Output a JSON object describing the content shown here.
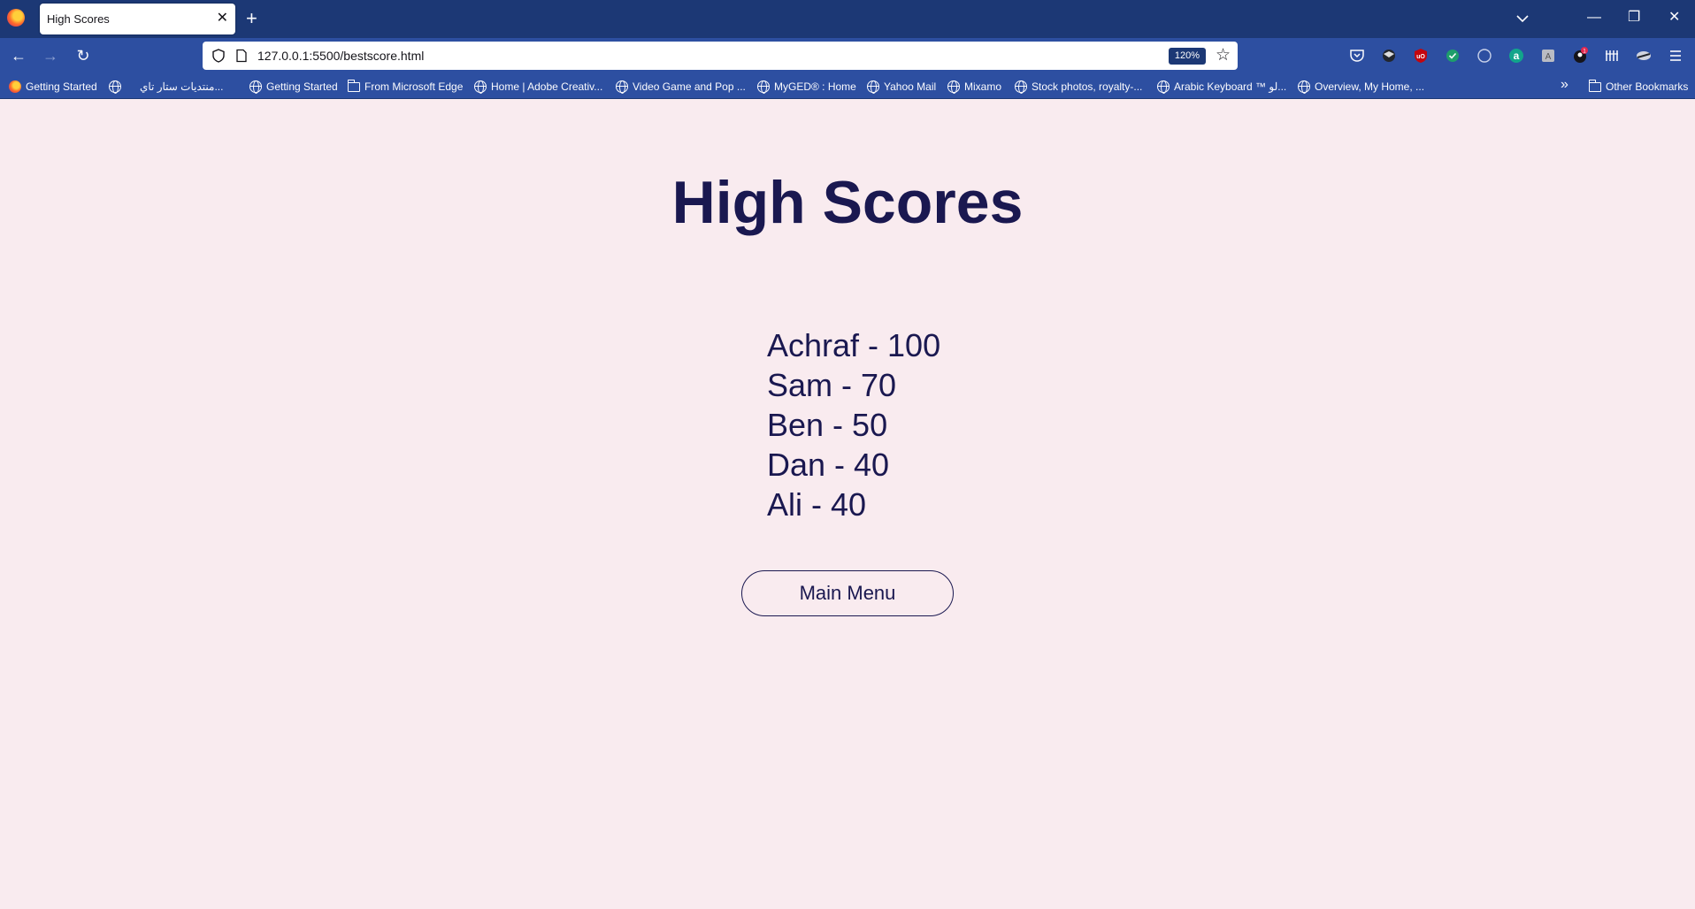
{
  "browser": {
    "tab": {
      "title": "High Scores",
      "close": "✕"
    },
    "new_tab": "+",
    "window_controls": {
      "minimize": "—",
      "restore": "❐",
      "close": "✕"
    },
    "nav": {
      "back": "←",
      "forward": "→",
      "reload": "↻"
    },
    "url": "127.0.0.1:5500/bestscore.html",
    "zoom": "120%",
    "bookmark_star": "☆",
    "extensions": [
      "pocket-icon",
      "extension-mask-icon",
      "ublock-icon",
      "check-extension-icon",
      "circle-extension-icon",
      "amazon-a-icon",
      "grey-extension-icon",
      "account-badge-icon",
      "library-icon",
      "sync-icon",
      "menu-icon"
    ],
    "extension_badge": "1",
    "bookmarks": [
      {
        "label": "Getting Started",
        "icon": "firefox-icon"
      },
      {
        "label": "",
        "icon": "globe-icon"
      },
      {
        "label": "منتديات ستار تاي...",
        "icon": "none"
      },
      {
        "label": "Getting Started",
        "icon": "globe-icon"
      },
      {
        "label": "From Microsoft Edge",
        "icon": "folder-icon"
      },
      {
        "label": "Home | Adobe Creativ...",
        "icon": "globe-icon"
      },
      {
        "label": "Video Game and Pop ...",
        "icon": "globe-icon"
      },
      {
        "label": "MyGED® : Home",
        "icon": "globe-icon"
      },
      {
        "label": "Yahoo Mail",
        "icon": "globe-icon"
      },
      {
        "label": "Mixamo",
        "icon": "globe-icon"
      },
      {
        "label": "Stock photos, royalty-...",
        "icon": "globe-icon"
      },
      {
        "label": "Arabic Keyboard ™ لو...",
        "icon": "globe-icon"
      },
      {
        "label": "Overview, My Home, ...",
        "icon": "globe-icon"
      }
    ],
    "bookmarks_overflow": "»",
    "other_bookmarks": "Other Bookmarks"
  },
  "page": {
    "title": "High Scores",
    "scores": [
      "Achraf - 100",
      "Sam - 70",
      "Ben - 50",
      "Dan - 40",
      "Ali - 40"
    ],
    "main_menu_label": "Main Menu"
  },
  "colors": {
    "titlebar": "#1c3875",
    "toolbar": "#2d4fa1",
    "page_background": "#f9ebef",
    "text": "#1a1850"
  }
}
